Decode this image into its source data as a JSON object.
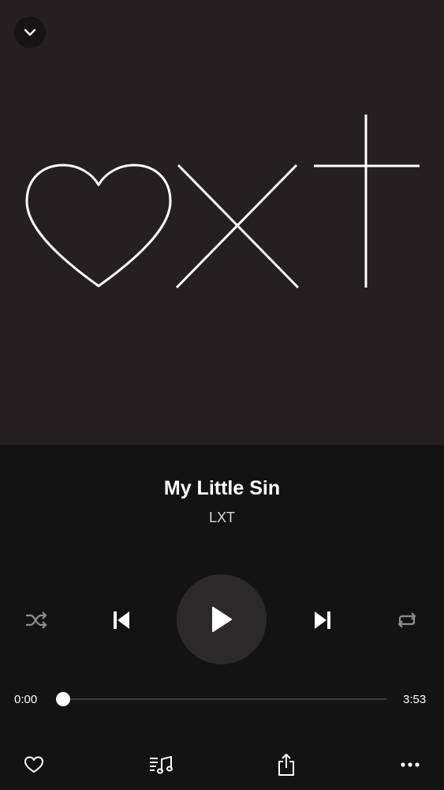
{
  "artwork": {
    "background": "#241f20",
    "icon": "heart-x-cross-artwork"
  },
  "header": {
    "collapse_icon": "chevron-down-icon"
  },
  "track": {
    "title": "My Little Sin",
    "artist": "LXT"
  },
  "controls": {
    "shuffle_icon": "shuffle-icon",
    "previous_icon": "skip-previous-icon",
    "play_icon": "play-icon",
    "next_icon": "skip-next-icon",
    "repeat_icon": "repeat-icon"
  },
  "progress": {
    "elapsed": "0:00",
    "duration": "3:53",
    "fraction": 0
  },
  "bottom_bar": {
    "like_icon": "heart-outline-icon",
    "queue_icon": "queue-music-icon",
    "share_icon": "share-icon",
    "more_icon": "more-horizontal-icon"
  },
  "colors": {
    "background": "#131313",
    "play_button": "#2b2929",
    "text_primary": "#ffffff",
    "inactive_icon": "#8e8e8e"
  }
}
